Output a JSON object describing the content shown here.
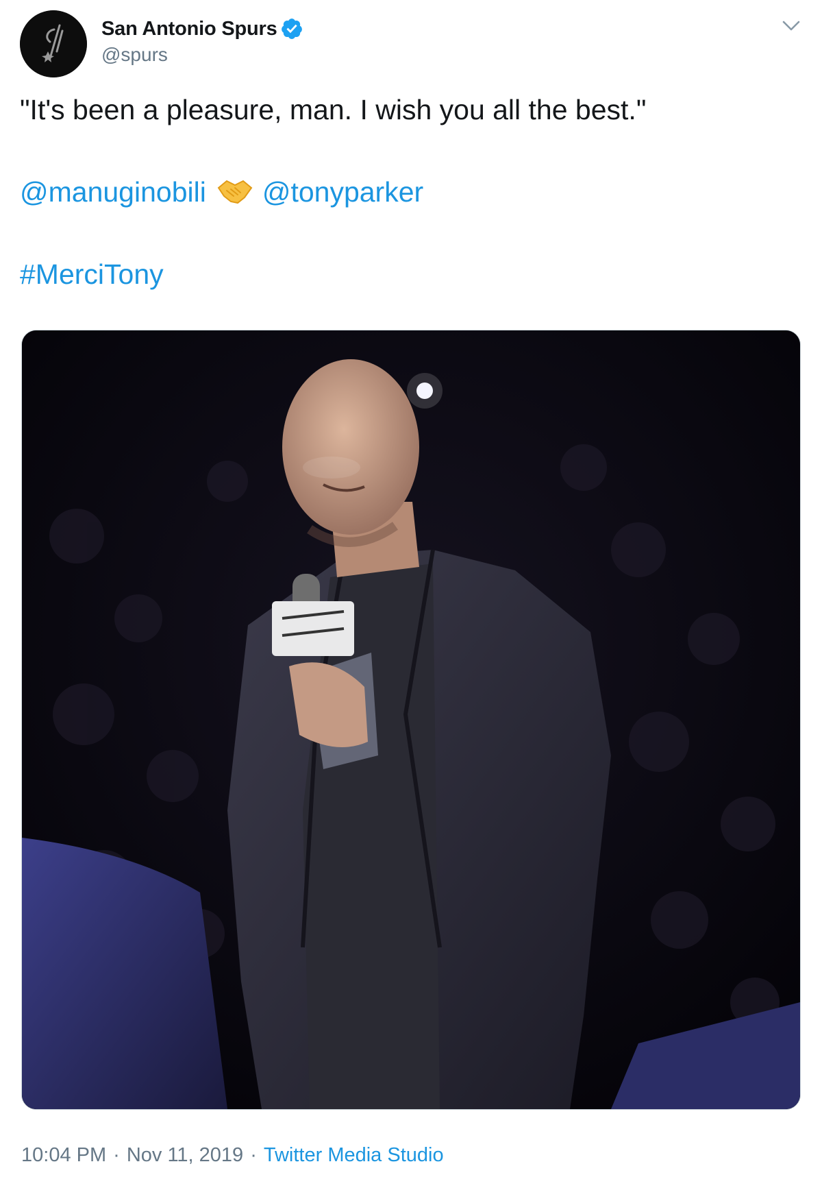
{
  "author": {
    "display_name": "San Antonio Spurs",
    "handle": "@spurs",
    "verified": true,
    "verified_color": "#1da1f2"
  },
  "tweet": {
    "quote": "\"It's been a pleasure, man. I wish you all the best.\"",
    "mention_1": "@manuginobili",
    "mention_2": "@tonyparker",
    "emoji": "handshake-icon",
    "hashtag": "#MerciTony"
  },
  "media": {
    "type": "video-frame",
    "subject": "man in dark blazer holding microphone"
  },
  "meta": {
    "time": "10:04 PM",
    "separator": "·",
    "date": "Nov 11, 2019",
    "source": "Twitter Media Studio"
  },
  "colors": {
    "link": "#1b95e0",
    "secondary_text": "#657786",
    "primary_text": "#14171a"
  }
}
